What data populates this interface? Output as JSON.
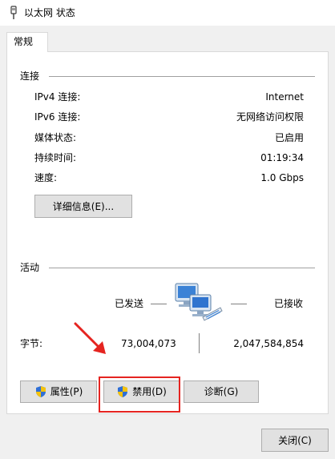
{
  "window": {
    "title": "以太网 状态"
  },
  "tabs": [
    {
      "label": "常规",
      "active": true
    }
  ],
  "connection": {
    "group_label": "连接",
    "rows": [
      {
        "label": "IPv4 连接:",
        "value": "Internet"
      },
      {
        "label": "IPv6 连接:",
        "value": "无网络访问权限"
      },
      {
        "label": "媒体状态:",
        "value": "已启用"
      },
      {
        "label": "持续时间:",
        "value": "01:19:34"
      },
      {
        "label": "速度:",
        "value": "1.0 Gbps"
      }
    ],
    "details_button": "详细信息(E)..."
  },
  "activity": {
    "group_label": "活动",
    "sent_label": "已发送",
    "received_label": "已接收",
    "bytes_label": "字节:",
    "bytes_sent": "73,004,073",
    "bytes_received": "2,047,584,854",
    "network_icon": "network-computers-icon"
  },
  "buttons": {
    "properties": "属性(P)",
    "disable": "禁用(D)",
    "diagnose": "诊断(G)",
    "close": "关闭(C)"
  },
  "colors": {
    "annotation": "#e52420",
    "shield_blue": "#2f6fd6",
    "shield_yellow": "#f4c20d"
  }
}
